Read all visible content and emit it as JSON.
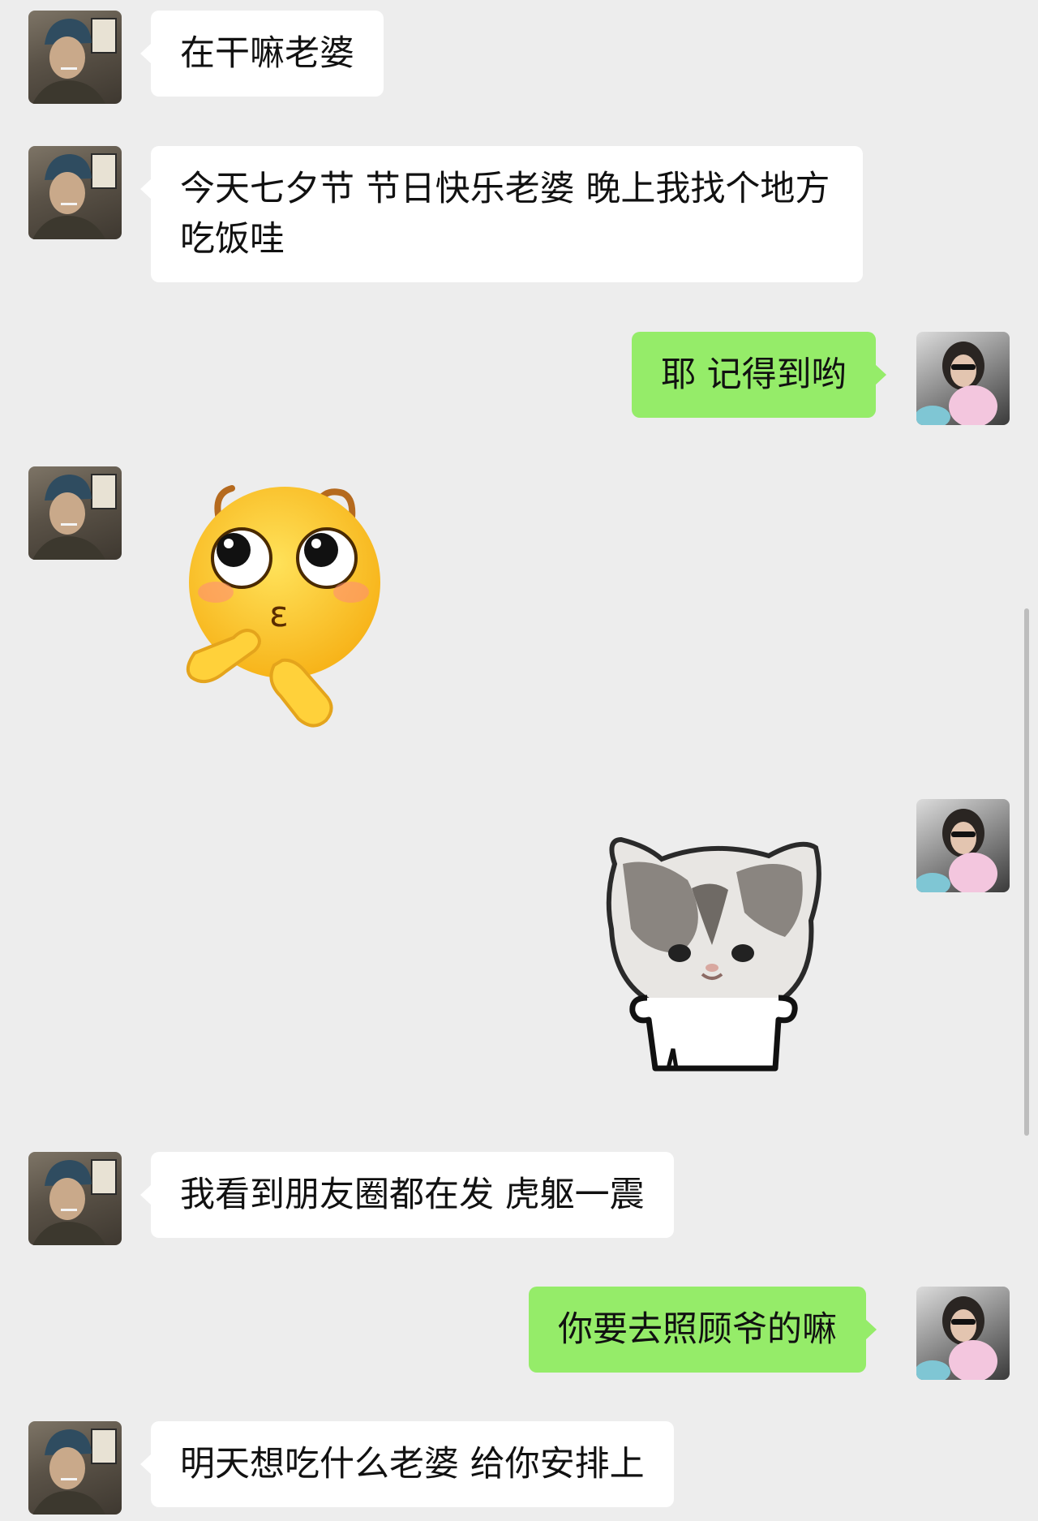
{
  "messages": [
    {
      "from": "other",
      "type": "text",
      "text": "在干嘛老婆"
    },
    {
      "from": "other",
      "type": "text",
      "text": "今天七夕节 节日快乐老婆 晚上我找个地方吃饭哇"
    },
    {
      "from": "self",
      "type": "text",
      "text": "耶 记得到哟"
    },
    {
      "from": "other",
      "type": "sticker",
      "sticker": "shy-kiss-emoji-sticker",
      "mouth_glyph": "ɛ"
    },
    {
      "from": "self",
      "type": "sticker",
      "sticker": "cat-meme-sticker"
    },
    {
      "from": "other",
      "type": "text",
      "text": "我看到朋友圈都在发 虎躯一震"
    },
    {
      "from": "self",
      "type": "text",
      "text": "你要去照顾爷的嘛"
    },
    {
      "from": "other",
      "type": "text",
      "text": "明天想吃什么老婆 给你安排上"
    }
  ],
  "colors": {
    "background": "#ededed",
    "incoming_bubble": "#ffffff",
    "outgoing_bubble": "#95ec69"
  }
}
